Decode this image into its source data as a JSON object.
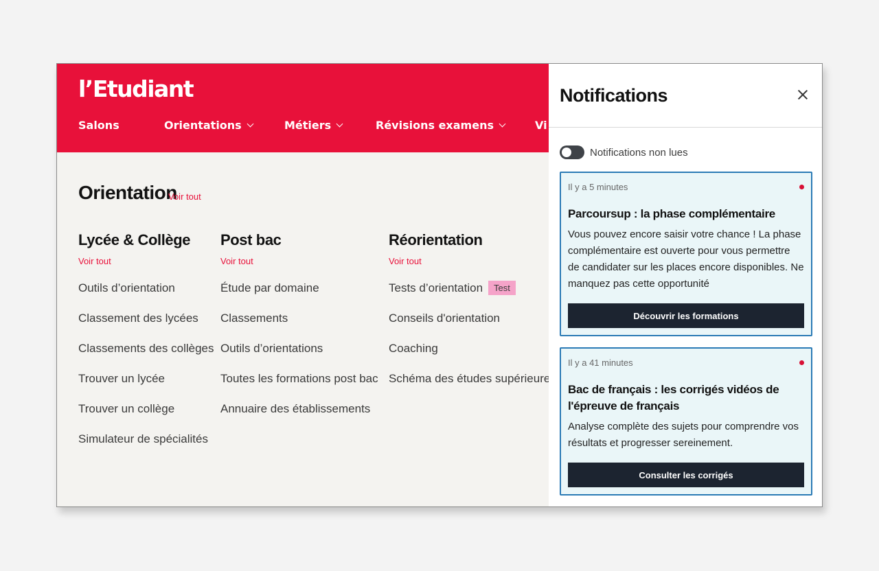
{
  "brand": {
    "logo_text": "l’Etudiant",
    "accent": "#e8113a"
  },
  "nav": {
    "items": [
      {
        "label": "Salons"
      },
      {
        "label": "Orientations"
      },
      {
        "label": "Métiers"
      },
      {
        "label": "Révisions examens"
      },
      {
        "label": "Vi"
      }
    ]
  },
  "section": {
    "title": "Orientation",
    "see_all": "Voir tout"
  },
  "columns": [
    {
      "title": "Lycée & Collège",
      "see_all": "Voir tout",
      "links": [
        "Outils d’orientation",
        "Classement des lycées",
        "Classements des collèges",
        "Trouver un lycée",
        "Trouver un collège",
        "Simulateur de spécialités"
      ]
    },
    {
      "title": "Post bac",
      "see_all": "Voir tout",
      "links": [
        "Étude par domaine",
        "Classements",
        "Outils d’orientations",
        "Toutes les formations post bac",
        "Annuaire des établissements"
      ]
    },
    {
      "title": "Réorientation",
      "see_all": "Voir tout",
      "links": [
        "Tests d’orientation",
        "Conseils d'orientation",
        "Coaching",
        "Schéma des études supérieures"
      ],
      "badge": "Test"
    }
  ],
  "notifications": {
    "title": "Notifications",
    "toggle_label": "Notifications non lues",
    "items": [
      {
        "time": "Il y a 5 minutes",
        "title": "Parcoursup : la phase complémentaire",
        "text": "Vous pouvez encore saisir votre chance ! La phase complémentaire est ouverte pour vous permettre de candidater sur les places encore disponibles. Ne manquez pas cette opportunité",
        "button": "Découvrir les formations"
      },
      {
        "time": "Il y a 41 minutes",
        "title": "Bac de français : les corrigés vidéos de l'épreuve de français",
        "text": "Analyse complète des sujets pour comprendre vos résultats et progresser sereinement.",
        "button": "Consulter les corrigés"
      }
    ]
  }
}
